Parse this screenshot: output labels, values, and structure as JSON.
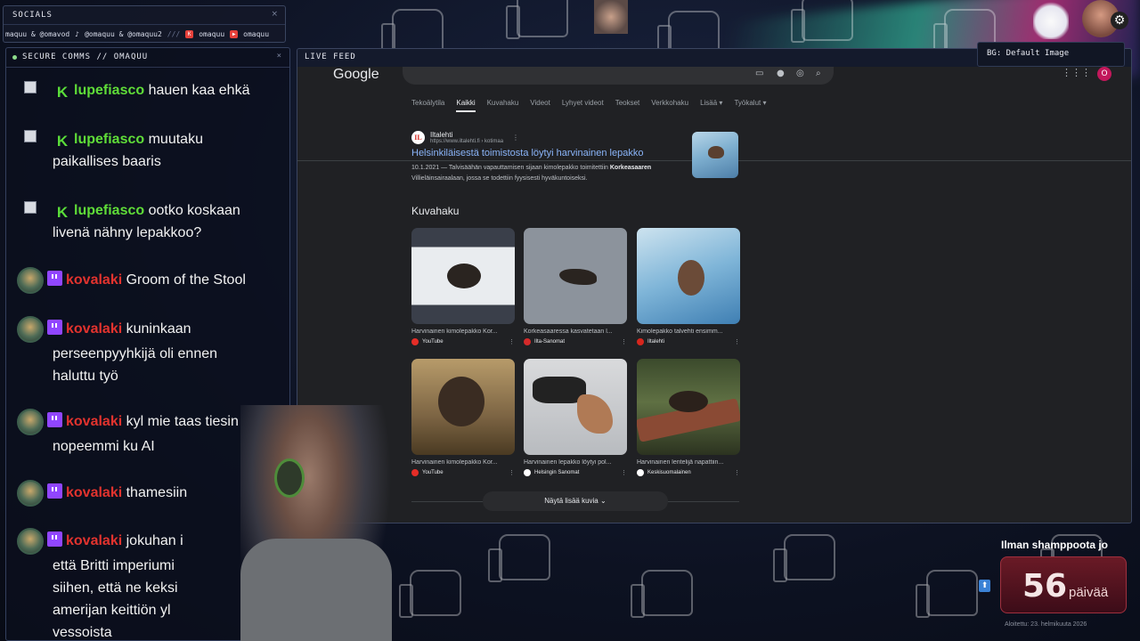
{
  "socials": {
    "title": "SOCIALS",
    "handles": [
      "maquu & @omavod",
      "@omaquu & @omaquu2",
      "///",
      "omaquu",
      "omaquu"
    ]
  },
  "chat": {
    "title": "SECURE COMMS // OMAQUU",
    "messages": [
      {
        "user": "lupefiasco",
        "text": "hauen kaa ehkä",
        "continuation": ""
      },
      {
        "user": "lupefiasco",
        "text": "muutaku",
        "continuation": "paikallises baaris"
      },
      {
        "user": "lupefiasco",
        "text": "ootko koskaan",
        "continuation": "livenä nähny lepakkoo?"
      },
      {
        "user": "kovalaki",
        "text": "Groom of the Stool",
        "continuation": ""
      },
      {
        "user": "kovalaki",
        "text": "kuninkaan",
        "continuation": "perseenpyyhkijä oli ennen",
        "continuation2": "haluttu työ"
      },
      {
        "user": "kovalaki",
        "text": "kyl mie taas tiesin",
        "continuation": "nopeemmi ku AI"
      },
      {
        "user": "kovalaki",
        "text": "thamesiin",
        "continuation": ""
      },
      {
        "user": "kovalaki",
        "text": "jokuhan i",
        "continuation": "että Britti imperiumi",
        "continuation2": "siihen, että ne keksi",
        "continuation3": "amerijan keittiön yl",
        "continuation4": "vessoista"
      }
    ]
  },
  "livefeed": {
    "title": "LIVE FEED",
    "google": {
      "logo": "Google",
      "tabs": [
        "Tekoälytila",
        "Kaikki",
        "Kuvahaku",
        "Videot",
        "Lyhyet videot",
        "Teokset",
        "Verkkohaku",
        "Lisää",
        "Työkalut"
      ],
      "active_tab": "Kaikki",
      "avatar_letter": "O",
      "result": {
        "site_name": "Iltalehti",
        "url": "https://www.iltalehti.fi › kotimaa",
        "title": "Helsinkiläisestä toimistosta löytyi harvinainen lepakko",
        "date": "10.1.2021",
        "snippet_a": "— Talvisäähän vapauttamisen sijaan kimolepakko toimitettiin",
        "snippet_bold": "Korkeasaaren",
        "snippet_b": "Villieläinsairaalaan, jossa se todettiin fyysisesti hyväkuntoiseksi."
      },
      "images_heading": "Kuvahaku",
      "images": [
        {
          "caption": "Harvinainen kimolepakko Kor...",
          "source": "YouTube"
        },
        {
          "caption": "Korkeasaaressa kasvatetaan l...",
          "source": "Ilta-Sanomat"
        },
        {
          "caption": "Kimolepakko talvehti ensimm...",
          "source": "Iltalehti"
        },
        {
          "caption": "Harvinainen kimolepakko Kor...",
          "source": "YouTube"
        },
        {
          "caption": "Harvinainen lepakko löytyi pol...",
          "source": "Helsingin Sanomat"
        },
        {
          "caption": "Harvinainen lentelijä napattiin...",
          "source": "Keskisuomalainen"
        }
      ],
      "show_more": "Näytä lisää kuvia"
    }
  },
  "bg_label": "BG: Default Image",
  "counter": {
    "title": "Ilman shamppoota jo",
    "value": "56",
    "unit": "päivää",
    "started": "Aloitettu: 23. helmikuuta 2026"
  },
  "colors": {
    "chat_name_green": "#5fdc38",
    "chat_name_red": "#e2332e",
    "google_link": "#8ab4f8",
    "counter_bg": "#6a1a26"
  }
}
